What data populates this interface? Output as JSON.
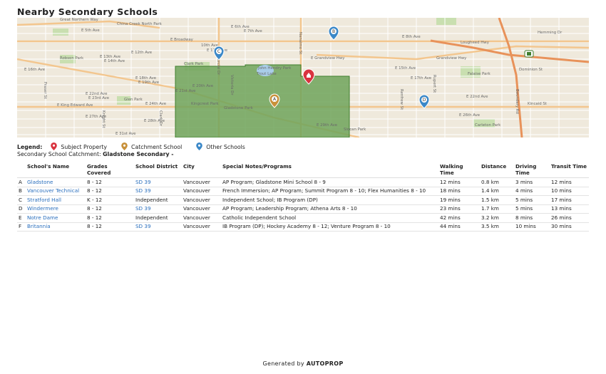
{
  "title": "Nearby Secondary Schools",
  "map": {
    "streets": [
      "Great Northern Way",
      "E 5th Ave",
      "E 6th Ave",
      "E 7th Ave",
      "E 8th Ave",
      "E Broadway",
      "10th Ave",
      "E 11th Ave",
      "E 12th Ave",
      "E 13th Ave",
      "E 14th Ave",
      "E 15th Ave",
      "E 16th Ave",
      "E 17th Ave",
      "E 18th Ave",
      "E 19th Ave",
      "E 20th Ave",
      "E 21st Ave",
      "E 22nd Ave",
      "E 23rd Ave",
      "E 24th Ave",
      "E 26th Ave",
      "E 27th Ave",
      "E 28th Ave",
      "E 29th Ave",
      "E 31st Ave",
      "E Grandview Hwy",
      "Grandview Hwy",
      "Dominion St",
      "Kincaid St",
      "Lougheed Hwy",
      "Hemming Dr",
      "Clark Park",
      "John Hendry Park",
      "Trout Lake",
      "Gladstone Park",
      "Slocan Park",
      "Falaise Park",
      "Robson Park",
      "Carleton Park",
      "China Creek North Park",
      "Glen Park",
      "Kingcrest Park",
      "E King Edward Ave",
      "Commercial Dr",
      "Victoria Dr",
      "Nanaimo St",
      "Rupert St",
      "Renfrew St",
      "Boundary Rd",
      "Clark Dr",
      "Fraser St",
      "Knight St"
    ],
    "colors": {
      "land": "#efe9dc",
      "road": "#ffffff",
      "major_road": "#f3c68e",
      "catchment_fill": "#6fa35a",
      "catchment_stroke": "#3f7e2e",
      "park": "#c9dfb0",
      "water": "#a9cde8",
      "highway": "#e8925a"
    },
    "markers": [
      {
        "letter": "A",
        "type": "catchment"
      },
      {
        "letter": "B",
        "type": "other"
      },
      {
        "letter": "C",
        "type": "other"
      },
      {
        "letter": "D",
        "type": "other"
      },
      {
        "letter": "",
        "type": "subject"
      }
    ]
  },
  "legend": {
    "label": "Legend:",
    "items": [
      {
        "text": "Subject Property",
        "color": "#d9333f",
        "icon": "subject-pin-icon"
      },
      {
        "text": "Catchment School",
        "color": "#c8913a",
        "icon": "catchment-pin-icon"
      },
      {
        "text": "Other Schools",
        "color": "#3b88c8",
        "icon": "school-pin-icon"
      }
    ]
  },
  "catchment": {
    "label": "Secondary School Catchment:",
    "value": "Gladstone Secondary -"
  },
  "table": {
    "headers": [
      "",
      "School's Name",
      "Grades Covered",
      "School District",
      "City",
      "Special Notes/Programs",
      "Walking Time",
      "Distance",
      "Driving Time",
      "Transit Time"
    ],
    "rows": [
      {
        "key": "A",
        "name": "Gladstone",
        "grades": "8 - 12",
        "district": "SD 39",
        "city": "Vancouver",
        "notes": "AP Program; Gladstone Mini School 8 - 9",
        "walk": "12 mins",
        "dist": "0.8 km",
        "drive": "3 mins",
        "transit": "12 mins"
      },
      {
        "key": "B",
        "name": "Vancouver Technical",
        "grades": "8 - 12",
        "district": "SD 39",
        "city": "Vancouver",
        "notes": "French Immersion; AP Program; Summit Program 8 - 10; Flex Humanities 8 - 10",
        "walk": "18 mins",
        "dist": "1.4 km",
        "drive": "4 mins",
        "transit": "10 mins"
      },
      {
        "key": "C",
        "name": "Stratford Hall",
        "grades": "K - 12",
        "district": "Independent",
        "city": "Vancouver",
        "notes": "Independent School; IB Program (DP)",
        "walk": "19 mins",
        "dist": "1.5 km",
        "drive": "5 mins",
        "transit": "17 mins"
      },
      {
        "key": "D",
        "name": "Windermere",
        "grades": "8 - 12",
        "district": "SD 39",
        "city": "Vancouver",
        "notes": "AP Program; Leadership Program; Athena Arts 8 - 10",
        "walk": "23 mins",
        "dist": "1.7 km",
        "drive": "5 mins",
        "transit": "13 mins"
      },
      {
        "key": "E",
        "name": "Notre Dame",
        "grades": "8 - 12",
        "district": "Independent",
        "city": "Vancouver",
        "notes": "Catholic Independent School",
        "walk": "42 mins",
        "dist": "3.2 km",
        "drive": "8 mins",
        "transit": "26 mins"
      },
      {
        "key": "F",
        "name": "Britannia",
        "grades": "8 - 12",
        "district": "SD 39",
        "city": "Vancouver",
        "notes": "IB Program (DP); Hockey Academy 8 - 12; Venture Program 8 - 10",
        "walk": "44 mins",
        "dist": "3.5 km",
        "drive": "10 mins",
        "transit": "30 mins"
      }
    ]
  },
  "footer": {
    "prefix": "Generated by",
    "brand": "AUTOPROP"
  }
}
